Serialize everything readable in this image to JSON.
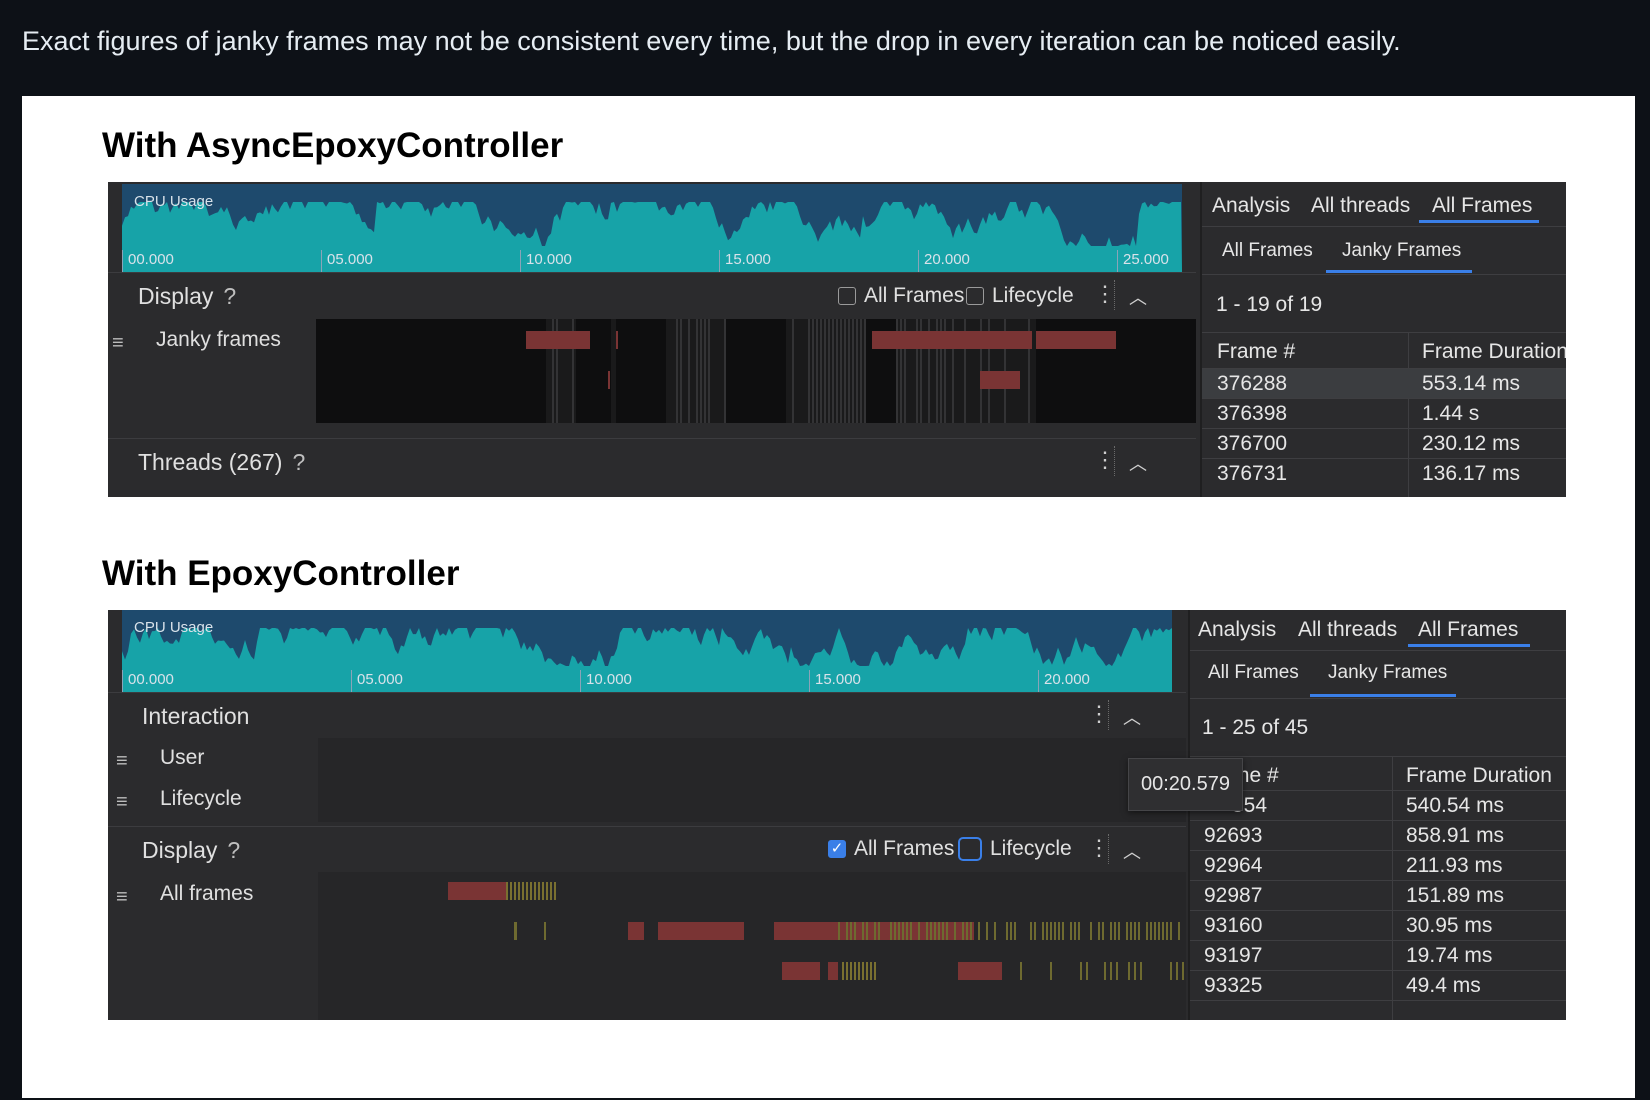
{
  "note": "Exact figures of janky frames may not be consistent every time, but the drop in every iteration can be noticed easily.",
  "colors": {
    "cpu_bg": "#1e4a6d",
    "cpu_fill": "#17a3a8",
    "janky": "#7a3434",
    "accent": "#3a7fe8"
  },
  "section1": {
    "heading": "With AsyncEpoxyController",
    "cpu": {
      "label": "CPU Usage",
      "ticks": [
        "00.000",
        "05.000",
        "10.000",
        "15.000",
        "20.000",
        "25.000"
      ]
    },
    "display": {
      "title": "Display",
      "help": "?",
      "all_frames_label": "All Frames",
      "lifecycle_label": "Lifecycle",
      "all_frames_checked": false,
      "lifecycle_checked": false
    },
    "janky_row_label": "Janky frames",
    "threads": {
      "title": "Threads (267)",
      "help": "?"
    },
    "panel": {
      "tabs": [
        "Analysis",
        "All threads",
        "All Frames"
      ],
      "subtabs": [
        "All Frames",
        "Janky Frames"
      ],
      "range": "1 - 19 of 19",
      "columns": [
        "Frame #",
        "Frame Duration"
      ],
      "rows": [
        {
          "frame": "376288",
          "duration": "553.14 ms"
        },
        {
          "frame": "376398",
          "duration": "1.44 s"
        },
        {
          "frame": "376700",
          "duration": "230.12 ms"
        },
        {
          "frame": "376731",
          "duration": "136.17 ms"
        }
      ]
    }
  },
  "section2": {
    "heading": "With EpoxyController",
    "cpu": {
      "label": "CPU Usage",
      "ticks": [
        "00.000",
        "05.000",
        "10.000",
        "15.000",
        "20.000"
      ]
    },
    "interaction": {
      "title": "Interaction",
      "user_label": "User",
      "lifecycle_label": "Lifecycle"
    },
    "display": {
      "title": "Display",
      "help": "?",
      "all_frames_label": "All Frames",
      "lifecycle_label": "Lifecycle",
      "all_frames_checked": true,
      "lifecycle_checked": false
    },
    "all_frames_row_label": "All frames",
    "tooltip": "00:20.579",
    "panel": {
      "tabs": [
        "Analysis",
        "All threads",
        "All Frames"
      ],
      "subtabs": [
        "All Frames",
        "Janky Frames"
      ],
      "range": "1 - 25 of 45",
      "columns": [
        "me #",
        "Frame Duration"
      ],
      "rows": [
        {
          "frame": "554",
          "duration": "540.54 ms"
        },
        {
          "frame": "92693",
          "duration": "858.91 ms"
        },
        {
          "frame": "92964",
          "duration": "211.93 ms"
        },
        {
          "frame": "92987",
          "duration": "151.89 ms"
        },
        {
          "frame": "93160",
          "duration": "30.95 ms"
        },
        {
          "frame": "93197",
          "duration": "19.74 ms"
        },
        {
          "frame": "93325",
          "duration": "49.4 ms"
        }
      ]
    }
  }
}
